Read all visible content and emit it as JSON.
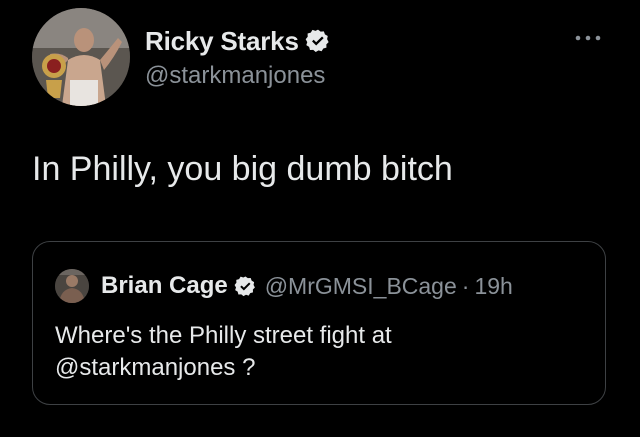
{
  "tweet": {
    "author": {
      "name": "Ricky Starks",
      "handle": "@starkmanjones",
      "verified": true,
      "avatar": "wrestler-with-belt-avatar"
    },
    "more_icon": "more-horizontal-icon",
    "text": "In Philly, you big dumb bitch"
  },
  "quote": {
    "author": {
      "name": "Brian Cage",
      "handle": "@MrGMSI_BCage",
      "verified": true,
      "avatar": "wrestler-avatar"
    },
    "separator": "·",
    "time": "19h",
    "text_line1": "Where's the Philly street fight at",
    "text_line2": "@starkmanjones ?"
  },
  "colors": {
    "background": "#000000",
    "primary_text": "#e7e9ea",
    "secondary_text": "#8b9299",
    "border": "#3e4144",
    "verified_badge": "#e7e9ea"
  }
}
